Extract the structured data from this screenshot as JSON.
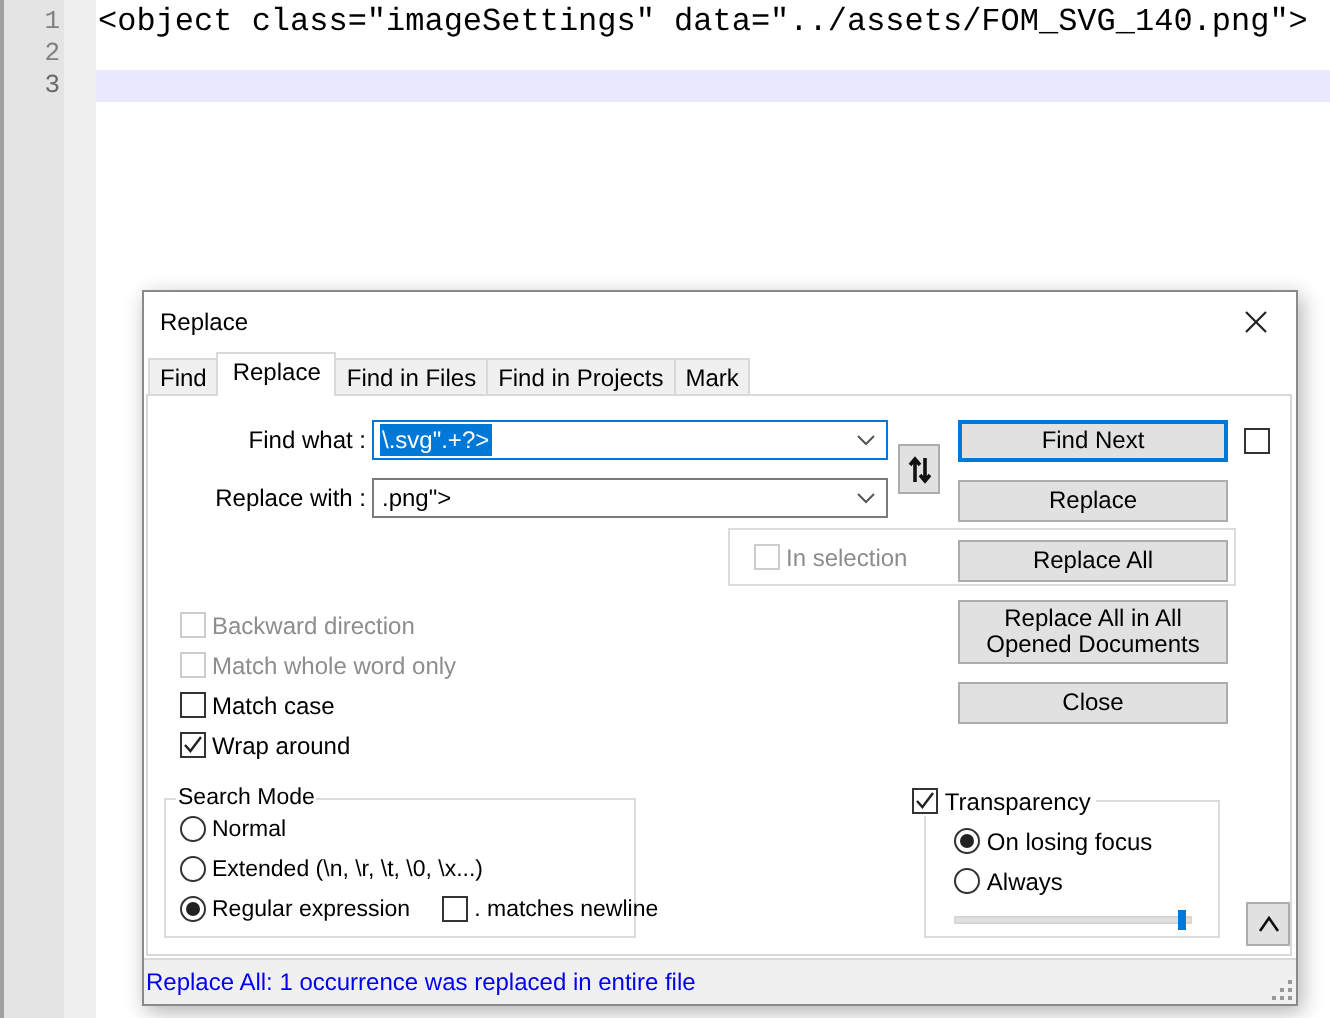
{
  "editor": {
    "lines": [
      {
        "number": "1",
        "text": "<object class=\"imageSettings\" data=\"../assets/FOM_SVG_140.png\">",
        "current": false
      },
      {
        "number": "2",
        "current": false
      },
      {
        "number": "3",
        "current": true
      }
    ]
  },
  "dialog": {
    "title": "Replace",
    "tabs": [
      {
        "label": "Find",
        "selected": false
      },
      {
        "label": "Replace",
        "selected": true
      },
      {
        "label": "Find in Files",
        "selected": false
      },
      {
        "label": "Find in Projects",
        "selected": false
      },
      {
        "label": "Mark",
        "selected": false
      }
    ],
    "find_what": {
      "label": "Find what :",
      "value": "\\.svg\".+?>",
      "value_selected": true,
      "focused": true
    },
    "replace_with": {
      "label": "Replace with :",
      "value": ".png\">",
      "value_selected": false,
      "focused": false
    },
    "buttons": [
      {
        "label": "Find Next",
        "default": true
      },
      {
        "label": "Replace",
        "default": false
      },
      {
        "label": "Replace All",
        "default": false
      },
      {
        "label": "Replace All in All Opened Documents",
        "default": false
      },
      {
        "label": "Close",
        "default": false
      }
    ],
    "find_next_checkbox": {
      "checked": false
    },
    "in_selection": {
      "label": "In selection",
      "checked": false,
      "disabled": true
    },
    "options": [
      {
        "label": "Backward direction",
        "checked": false,
        "disabled": true
      },
      {
        "label": "Match whole word only",
        "checked": false,
        "disabled": true
      },
      {
        "label": "Match case",
        "checked": false,
        "disabled": false
      },
      {
        "label": "Wrap around",
        "checked": true,
        "disabled": false
      }
    ],
    "search_mode": {
      "title": "Search Mode",
      "modes": [
        {
          "label": "Normal",
          "selected": false
        },
        {
          "label": "Extended (\\n, \\r, \\t, \\0, \\x...)",
          "selected": false
        },
        {
          "label": "Regular expression",
          "selected": true
        }
      ],
      "dot_matches_newline": {
        "label": ". matches newline",
        "checked": false
      }
    },
    "transparency": {
      "label": "Transparency",
      "checked": true,
      "modes": [
        {
          "label": "On losing focus",
          "selected": true
        },
        {
          "label": "Always",
          "selected": false
        }
      ],
      "level": 0.97
    },
    "status_bar": "Replace All: 1 occurrence was replaced in entire file"
  }
}
